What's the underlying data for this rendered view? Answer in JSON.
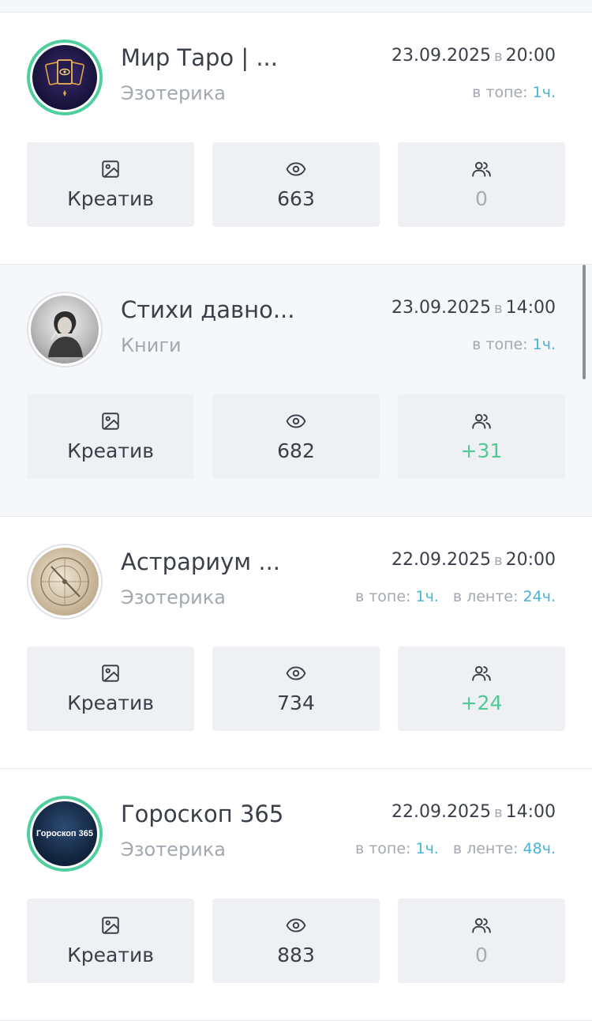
{
  "cards": [
    {
      "name": "Мир Таро | ...",
      "category": "Эзотерика",
      "date": "23.09.2025",
      "date_sep": "в",
      "time": "20:00",
      "top_label": "в топе:",
      "top_value": "1ч.",
      "feed_label": "",
      "feed_value": "",
      "creative_label": "Креатив",
      "views": "663",
      "subscribers": "0"
    },
    {
      "name": "Стихи давно...",
      "category": "Книги",
      "date": "23.09.2025",
      "date_sep": "в",
      "time": "14:00",
      "top_label": "в топе:",
      "top_value": "1ч.",
      "feed_label": "",
      "feed_value": "",
      "creative_label": "Креатив",
      "views": "682",
      "subscribers": "+31"
    },
    {
      "name": "Астрариум ...",
      "category": "Эзотерика",
      "date": "22.09.2025",
      "date_sep": "в",
      "time": "20:00",
      "top_label": "в топе:",
      "top_value": "1ч.",
      "feed_label": "в ленте:",
      "feed_value": "24ч.",
      "creative_label": "Креатив",
      "views": "734",
      "subscribers": "+24"
    },
    {
      "name": "Гороскоп 365",
      "category": "Эзотерика",
      "date": "22.09.2025",
      "date_sep": "в",
      "time": "14:00",
      "top_label": "в топе:",
      "top_value": "1ч.",
      "feed_label": "в ленте:",
      "feed_value": "48ч.",
      "creative_label": "Креатив",
      "views": "883",
      "subscribers": "0",
      "avatar_text": "Гороскоп 365"
    }
  ],
  "colors": {
    "accent_ring": "#4fcf9d",
    "positive": "#4fc995",
    "link_value": "#47b3d6",
    "muted": "#a3a8b1",
    "tile_bg": "#eef0f4"
  },
  "icons": {
    "creative": "image-icon",
    "views": "eye-icon",
    "subscribers": "users-icon"
  }
}
